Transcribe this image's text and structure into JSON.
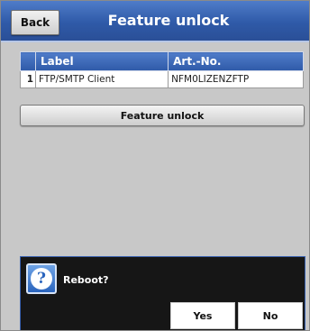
{
  "header": {
    "back_label": "Back",
    "title": "Feature unlock"
  },
  "table": {
    "columns": [
      "Label",
      "Art.-No."
    ],
    "rows": [
      {
        "index": "1",
        "label": "FTP/SMTP Client",
        "art_no": "NFM0LIZENZFTP"
      }
    ]
  },
  "actions": {
    "feature_unlock_label": "Feature unlock"
  },
  "dialog": {
    "icon": "question-icon",
    "message": "Reboot?",
    "yes_label": "Yes",
    "no_label": "No"
  },
  "colors": {
    "accent": "#2f5aa8",
    "dialog_bg": "#161616"
  }
}
